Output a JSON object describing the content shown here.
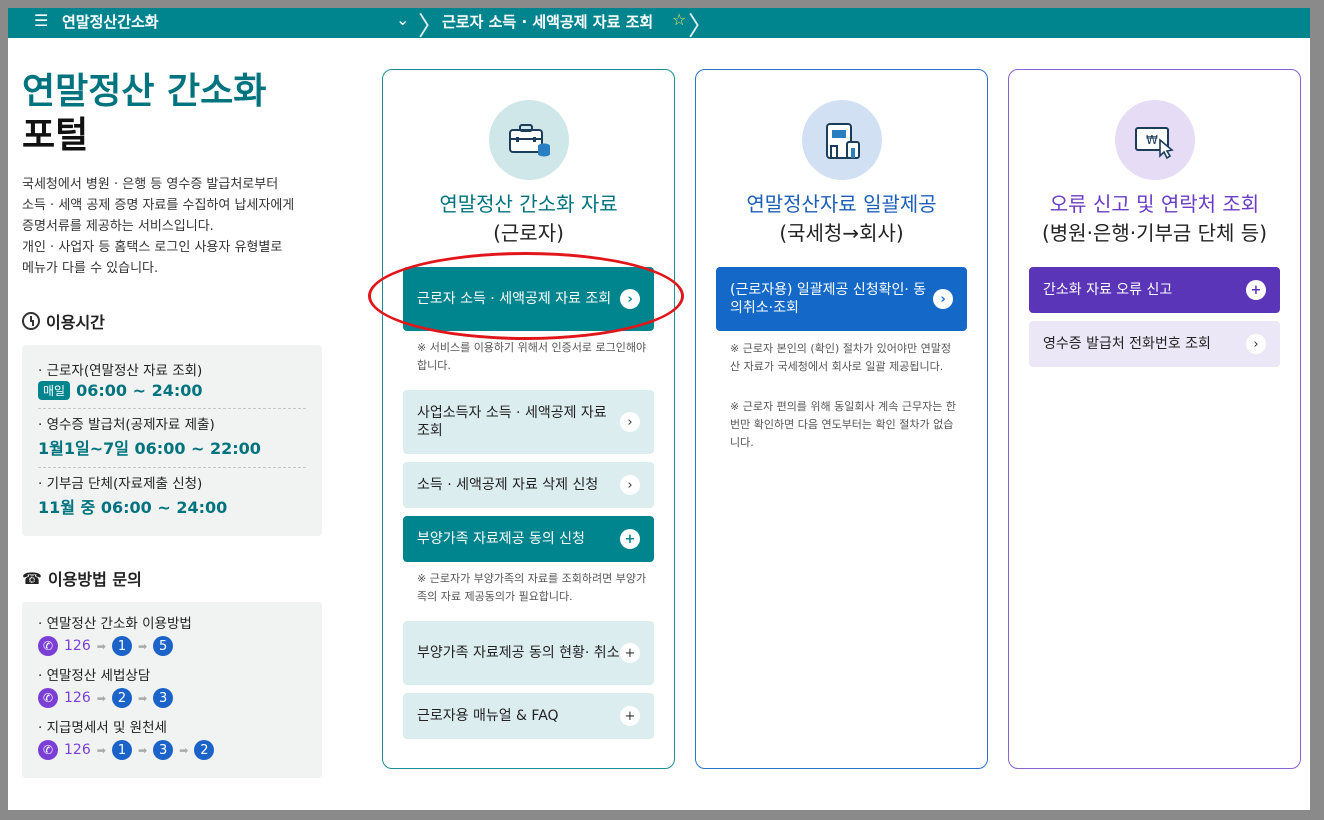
{
  "topbar": {
    "portal_name": "연말정산간소화",
    "breadcrumb_current": "근로자 소득 · 세액공제 자료 조회"
  },
  "left": {
    "title_line1": "연말정산 간소화",
    "title_line2": "포털",
    "description": [
      "국세청에서 병원 · 은행 등 영수증 발급처로부터",
      "소득 · 세액 공제 증명 자료를 수집하여 납세자에게",
      "증명서류를 제공하는 서비스입니다.",
      "개인 · 사업자 등 홈택스 로그인 사용자 유형별로",
      "메뉴가 다를 수 있습니다."
    ],
    "hours_title": "이용시간",
    "hours": [
      {
        "label": "· 근로자(연말정산 자료 조회)",
        "badge": "매일",
        "time": "06:00 ~ 24:00"
      },
      {
        "label": "· 영수증 발급처(공제자료 제출)",
        "badge": "",
        "time": "1월1일~7일 06:00 ~ 22:00"
      },
      {
        "label": "· 기부금 단체(자료제출 신청)",
        "badge": "",
        "time": "11월 중 06:00 ~ 24:00"
      }
    ],
    "contact_title": "이용방법 문의",
    "contacts": [
      {
        "label": "· 연말정산 간소화 이용방법",
        "phone": "126",
        "steps": [
          "1",
          "5"
        ]
      },
      {
        "label": "· 연말정산 세법상담",
        "phone": "126",
        "steps": [
          "2",
          "3"
        ]
      },
      {
        "label": "· 지급명세서 및 원천세",
        "phone": "126",
        "steps": [
          "1",
          "3",
          "2"
        ]
      }
    ]
  },
  "cards": {
    "worker": {
      "title1": "연말정산 간소화 자료",
      "title2": "(근로자)",
      "btn_main": "근로자 소득 · 세액공제 자료 조회",
      "note1": "※ 서비스를 이용하기 위해서 인증서로 로그인해야 합니다.",
      "btn_business": "사업소득자 소득 · 세액공제 자료 조회",
      "btn_delete": "소득 · 세액공제 자료 삭제 신청",
      "btn_dependent": "부양가족 자료제공 동의 신청",
      "note2": "※ 근로자가 부양가족의 자료를 조회하려면 부양가족의 자료 제공동의가 필요합니다.",
      "btn_dependent_status": "부양가족 자료제공 동의 현황· 취소",
      "btn_manual": "근로자용 매뉴얼 & FAQ"
    },
    "bulk": {
      "title1": "연말정산자료 일괄제공",
      "title2": "(국세청→회사)",
      "btn_main": "(근로자용) 일괄제공 신청확인· 동의취소·조회",
      "note1": "※ 근로자 본인의 (확인) 절차가 있어야만 연말정산 자료가 국세청에서 회사로 일괄 제공됩니다.",
      "note2": "※ 근로자 편의를 위해 동일회사 계속 근무자는 한 번만 확인하면 다음 연도부터는 확인 절차가 없습니다."
    },
    "error": {
      "title1": "오류 신고 및 연락처 조회",
      "title2": "(병원·은행·기부금 단체 등)",
      "btn_error": "간소화 자료 오류 신고",
      "btn_phone": "영수증 발급처 전화번호 조회"
    }
  }
}
